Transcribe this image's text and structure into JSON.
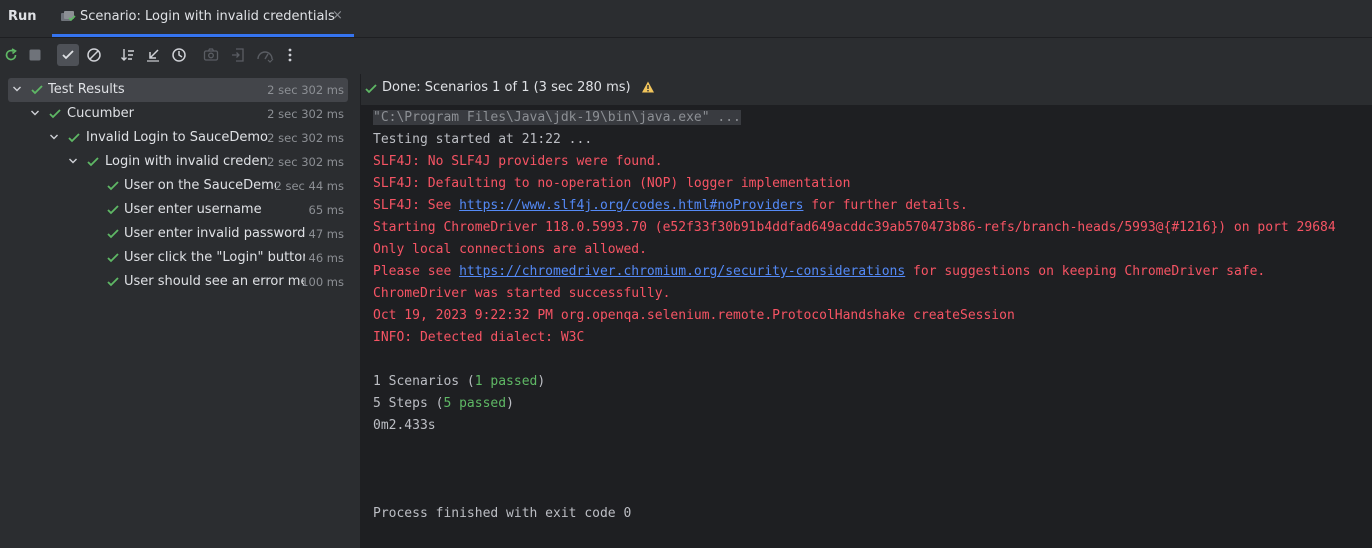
{
  "header": {
    "run_title": "Run",
    "tab_label": "Scenario: Login with invalid credentials",
    "tab_close": "×"
  },
  "toolbar": {
    "buttons": [
      "rerun-icon",
      "stop-icon",
      "show-passed-icon",
      "show-ignored-icon",
      "sort-alpha-icon",
      "collapse-icon",
      "history-icon",
      "screenshot-icon",
      "import-icon",
      "gauge-icon",
      "more-icon"
    ]
  },
  "tree": {
    "items": [
      {
        "label": "Test Results",
        "time": "2 sec 302 ms"
      },
      {
        "label": "Cucumber",
        "time": "2 sec 302 ms"
      },
      {
        "label": "Invalid Login to SauceDemo",
        "time": "2 sec 302 ms"
      },
      {
        "label": "Login with invalid credentials",
        "time": "2 sec 302 ms"
      },
      {
        "label": "User on the SauceDemo",
        "time": "2 sec 44 ms"
      },
      {
        "label": "User enter username",
        "time": "65 ms"
      },
      {
        "label": "User enter invalid password",
        "time": "47 ms"
      },
      {
        "label": "User click the \"Login\" button",
        "time": "46 ms"
      },
      {
        "label": "User should see an error message",
        "time": "100 ms"
      }
    ]
  },
  "status": {
    "text": "Done: Scenarios 1 of 1  (3 sec 280 ms)"
  },
  "console": {
    "cmd": "\"C:\\Program Files\\Java\\jdk-19\\bin\\java.exe\" ...",
    "testing_started": "Testing started at 21:22 ...",
    "slf_1": "SLF4J: No SLF4J providers were found.",
    "slf_2": "SLF4J: Defaulting to no-operation (NOP) logger implementation",
    "slf_3_pre": "SLF4J: See ",
    "slf_3_link": "https://www.slf4j.org/codes.html#noProviders",
    "slf_3_post": " for further details.",
    "chromedriver_start": "Starting ChromeDriver 118.0.5993.70 (e52f33f30b91b4ddfad649acddc39ab570473b86-refs/branch-heads/5993@{#1216}) on port 29684",
    "local_only": "Only local connections are allowed.",
    "see_pre": "Please see ",
    "see_link": "https://chromedriver.chromium.org/security-considerations",
    "see_post": " for suggestions on keeping ChromeDriver safe.",
    "started_ok": "ChromeDriver was started successfully.",
    "handshake": "Oct 19, 2023 9:22:32 PM org.openqa.selenium.remote.ProtocolHandshake createSession",
    "dialect": "INFO: Detected dialect: W3C",
    "scenarios_pre": "1 Scenarios (",
    "scenarios_passed": "1 passed",
    "scenarios_post": ")",
    "steps_pre": "5 Steps (",
    "steps_passed": "5 passed",
    "steps_post": ")",
    "duration": "0m2.433s",
    "exit": "Process finished with exit code 0"
  },
  "colors": {
    "accent": "#3574f0",
    "pass": "#5fb865",
    "error": "#f75464",
    "link": "#548af7",
    "warning": "#f2c55c"
  }
}
